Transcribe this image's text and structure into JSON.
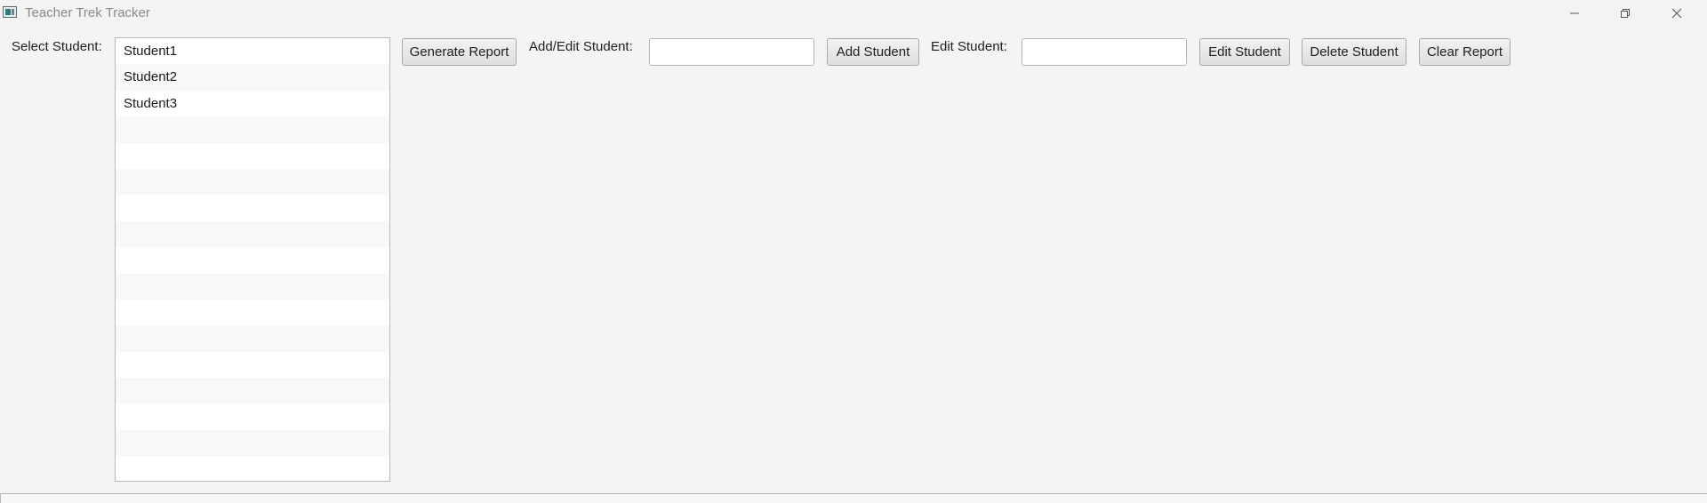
{
  "window": {
    "title": "Teacher Trek Tracker"
  },
  "labels": {
    "select_student": "Select Student:",
    "add_edit_student": "Add/Edit Student:",
    "edit_student": "Edit Student:"
  },
  "students": [
    "Student1",
    "Student2",
    "Student3"
  ],
  "buttons": {
    "generate_report": "Generate Report",
    "add_student": "Add Student",
    "edit_student": "Edit Student",
    "delete_student": "Delete Student",
    "clear_report": "Clear Report"
  },
  "inputs": {
    "add_edit_value": "",
    "edit_value": ""
  },
  "icons": {
    "app": "app-icon",
    "minimize": "minimize-icon",
    "maximize": "restore-icon",
    "close": "close-icon"
  },
  "colors": {
    "background": "#f4f4f4",
    "list_alt_row": "#f8f8f8",
    "button_border": "#a9a9a9"
  }
}
